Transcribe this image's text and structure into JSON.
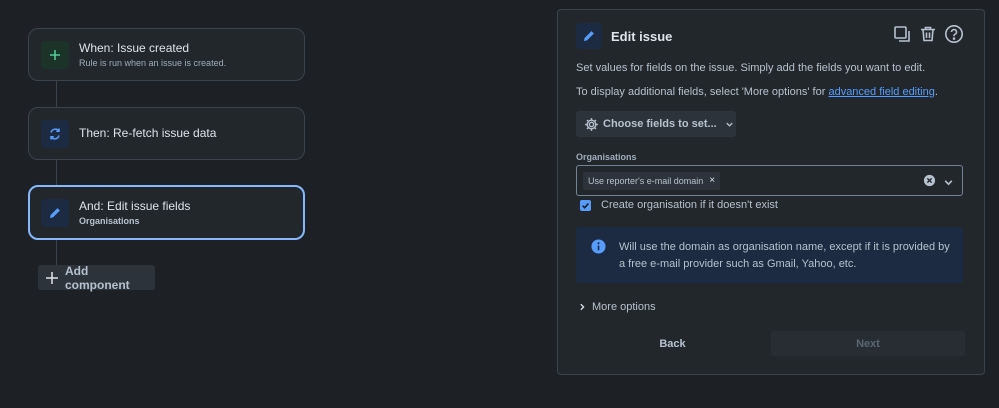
{
  "flow": {
    "trigger": {
      "title": "When: Issue created",
      "subtitle": "Rule is run when an issue is created."
    },
    "action1": {
      "title": "Then: Re-fetch issue data"
    },
    "action2": {
      "title": "And: Edit issue fields",
      "subtitle": "Organisations"
    },
    "add_component_label": "Add component",
    "icons": {
      "trigger": "plus-icon",
      "action1": "refresh-icon",
      "action2": "pencil-icon",
      "add": "plus-icon"
    }
  },
  "panel": {
    "title": "Edit issue",
    "description_1": "Set values for fields on the issue. Simply add the fields you want to edit.",
    "description_2_prefix": "To display additional fields, select 'More options' for ",
    "description_2_link": "advanced field editing",
    "description_2_suffix": ".",
    "choose_fields_label": "Choose fields to set...",
    "field_label": "Organisations",
    "selected_tag": "Use reporter's e-mail domain",
    "checkbox_label": "Create organisation if it doesn't exist",
    "checkbox_checked": true,
    "info_text": "Will use the domain as organisation name, except if it is provided by a free e-mail provider such as Gmail, Yahoo, etc.",
    "more_options_label": "More options",
    "back_label": "Back",
    "next_label": "Next",
    "actions": [
      "duplicate-icon",
      "trash-icon",
      "help-icon"
    ]
  },
  "colors": {
    "background": "#1d2125",
    "card": "#22272b",
    "border": "#3b434c",
    "selected_border": "#85b8ff",
    "accent_blue": "#579dff",
    "trigger_green": "#4bce97",
    "info_bg": "#1c2b41"
  }
}
